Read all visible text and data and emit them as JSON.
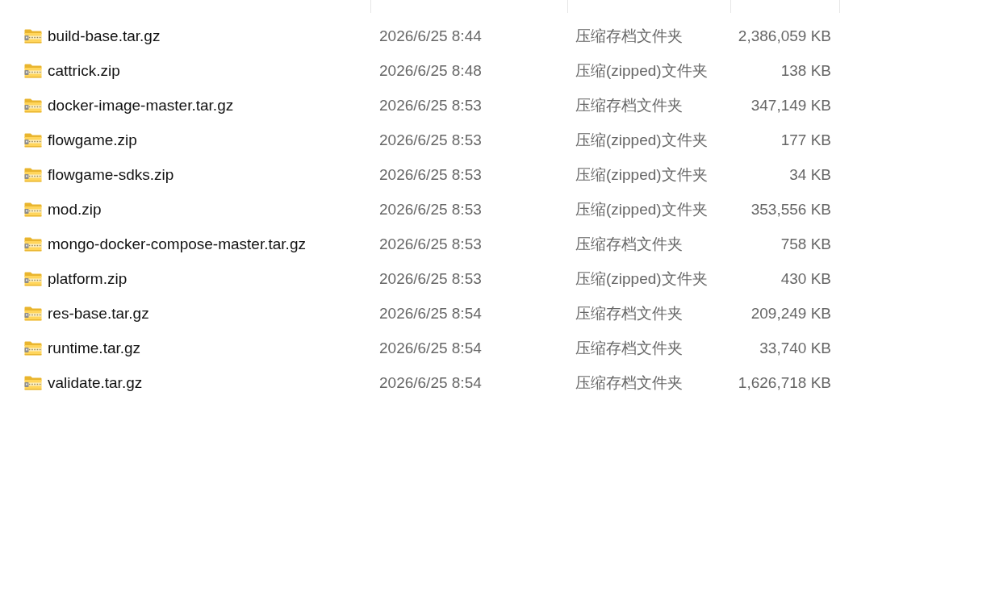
{
  "file_list": {
    "rows": [
      {
        "name": "build-base.tar.gz",
        "modified": "2026/6/25 8:44",
        "type": "压缩存档文件夹",
        "size": "2,386,059 KB"
      },
      {
        "name": "cattrick.zip",
        "modified": "2026/6/25 8:48",
        "type": "压缩(zipped)文件夹",
        "size": "138 KB"
      },
      {
        "name": "docker-image-master.tar.gz",
        "modified": "2026/6/25 8:53",
        "type": "压缩存档文件夹",
        "size": "347,149 KB"
      },
      {
        "name": "flowgame.zip",
        "modified": "2026/6/25 8:53",
        "type": "压缩(zipped)文件夹",
        "size": "177 KB"
      },
      {
        "name": "flowgame-sdks.zip",
        "modified": "2026/6/25 8:53",
        "type": "压缩(zipped)文件夹",
        "size": "34 KB"
      },
      {
        "name": "mod.zip",
        "modified": "2026/6/25 8:53",
        "type": "压缩(zipped)文件夹",
        "size": "353,556 KB"
      },
      {
        "name": "mongo-docker-compose-master.tar.gz",
        "modified": "2026/6/25 8:53",
        "type": "压缩存档文件夹",
        "size": "758 KB"
      },
      {
        "name": "platform.zip",
        "modified": "2026/6/25 8:53",
        "type": "压缩(zipped)文件夹",
        "size": "430 KB"
      },
      {
        "name": "res-base.tar.gz",
        "modified": "2026/6/25 8:54",
        "type": "压缩存档文件夹",
        "size": "209,249 KB"
      },
      {
        "name": "runtime.tar.gz",
        "modified": "2026/6/25 8:54",
        "type": "压缩存档文件夹",
        "size": "33,740 KB"
      },
      {
        "name": "validate.tar.gz",
        "modified": "2026/6/25 8:54",
        "type": "压缩存档文件夹",
        "size": "1,626,718 KB"
      }
    ]
  }
}
